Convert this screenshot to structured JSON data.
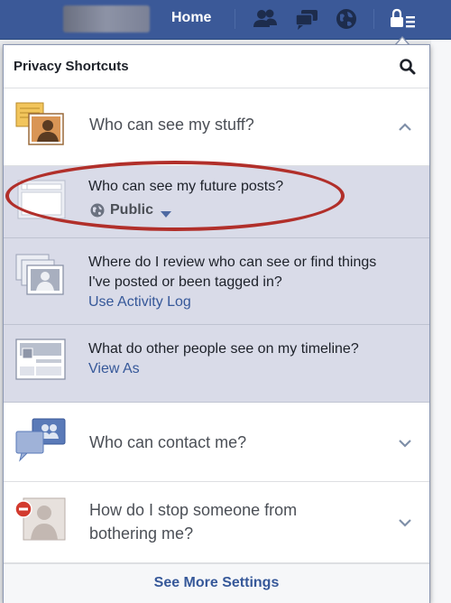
{
  "topbar": {
    "home_label": "Home"
  },
  "panel": {
    "title": "Privacy Shortcuts",
    "sections": [
      {
        "label": "Who can see my stuff?",
        "expanded": true
      },
      {
        "label": "Who can contact me?",
        "expanded": false
      },
      {
        "label": "How do I stop someone from bothering me?",
        "expanded": false
      }
    ],
    "subitems": [
      {
        "question": "Who can see my future posts?",
        "value": "Public"
      },
      {
        "question": "Where do I review who can see or find things I've posted or been tagged in?",
        "link": "Use Activity Log"
      },
      {
        "question": "What do other people see on my timeline?",
        "link": "View As"
      }
    ],
    "footer_link": "See More Settings"
  },
  "colors": {
    "topbar": "#3b5998",
    "link": "#365899",
    "subitem_bg": "#d9dbe8",
    "highlight": "#b12f2a"
  }
}
